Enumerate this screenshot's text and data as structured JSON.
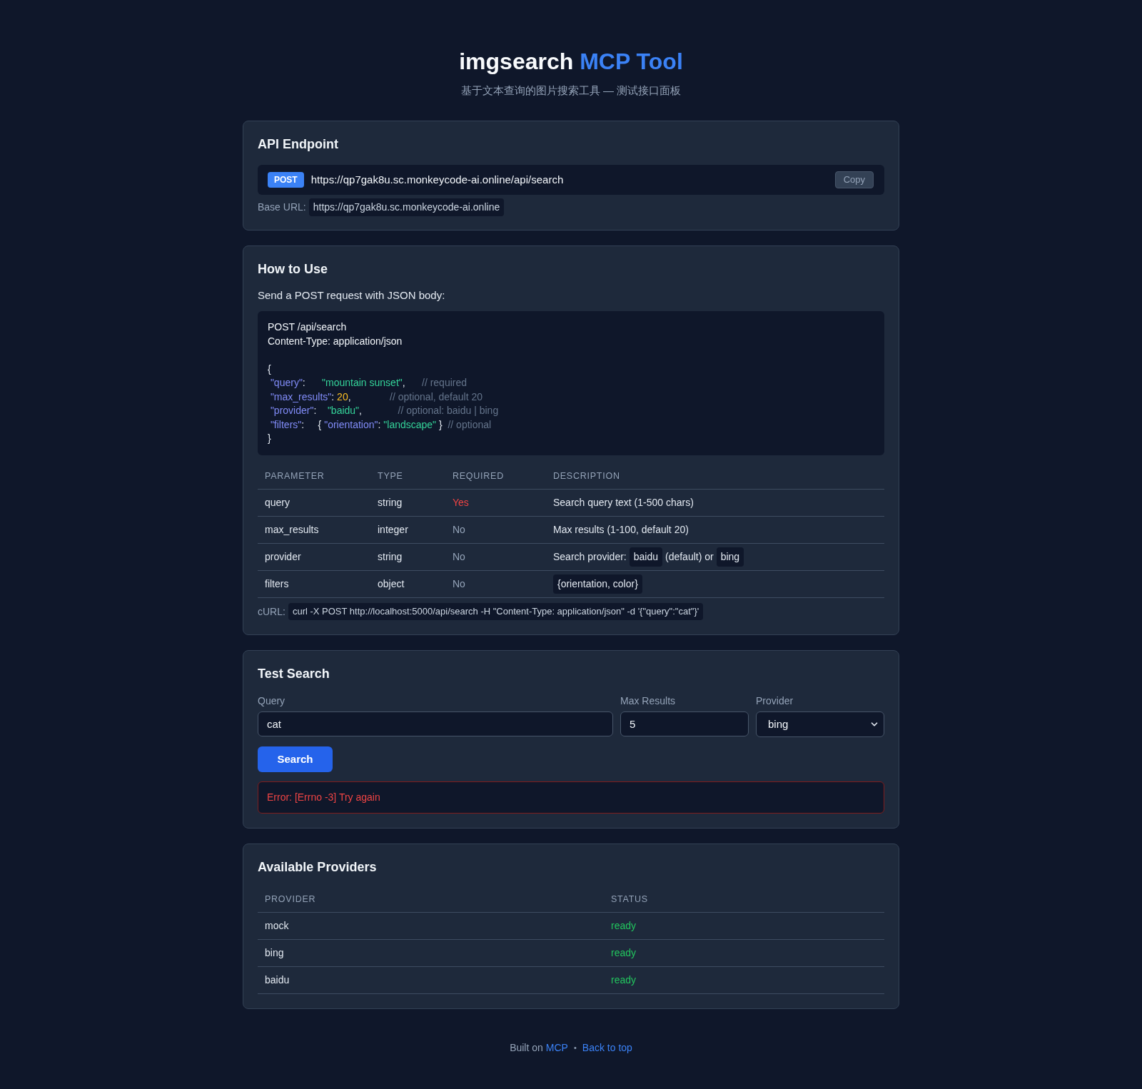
{
  "header": {
    "title": "imgsearch",
    "title_accent": "MCP Tool",
    "subtitle": "基于文本查询的图片搜索工具 — 测试接口面板"
  },
  "endpoint_card": {
    "heading": "API Endpoint",
    "method": "POST",
    "url": "https://qp7gak8u.sc.monkeycode-ai.online/api/search",
    "copy_button": "Copy",
    "base_url_label": "Base URL:",
    "base_url": "https://qp7gak8u.sc.monkeycode-ai.online"
  },
  "usage_card": {
    "heading": "How to Use",
    "intro": "Send a POST request with JSON body:",
    "request_lines": [
      "POST /api/search",
      "Content-Type: application/json"
    ],
    "body_lines": [
      [
        {
          "kind": "plain",
          "text": "{"
        }
      ],
      [
        {
          "kind": "key",
          "text": " \"query\""
        },
        {
          "kind": "plain",
          "text": ":      "
        },
        {
          "kind": "string",
          "text": "\"mountain sunset\""
        },
        {
          "kind": "plain",
          "text": ",      "
        },
        {
          "kind": "comment",
          "text": "// required"
        }
      ],
      [
        {
          "kind": "key",
          "text": " \"max_results\""
        },
        {
          "kind": "plain",
          "text": ": "
        },
        {
          "kind": "number",
          "text": "20"
        },
        {
          "kind": "plain",
          "text": ",              "
        },
        {
          "kind": "comment",
          "text": "// optional, default 20"
        }
      ],
      [
        {
          "kind": "key",
          "text": " \"provider\""
        },
        {
          "kind": "plain",
          "text": ":    "
        },
        {
          "kind": "string",
          "text": "\"baidu\""
        },
        {
          "kind": "plain",
          "text": ",             "
        },
        {
          "kind": "comment",
          "text": "// optional: baidu | bing"
        }
      ],
      [
        {
          "kind": "key",
          "text": " \"filters\""
        },
        {
          "kind": "plain",
          "text": ":     { "
        },
        {
          "kind": "key",
          "text": "\"orientation\""
        },
        {
          "kind": "plain",
          "text": ": "
        },
        {
          "kind": "string",
          "text": "\"landscape\""
        },
        {
          "kind": "plain",
          "text": " }  "
        },
        {
          "kind": "comment",
          "text": "// optional"
        }
      ],
      [
        {
          "kind": "plain",
          "text": "}"
        }
      ]
    ],
    "params_table": {
      "columns": [
        "PARAMETER",
        "TYPE",
        "REQUIRED",
        "DESCRIPTION"
      ],
      "rows": [
        {
          "parameter": "query",
          "type": "string",
          "required": {
            "text": "Yes",
            "on": true
          },
          "description": [
            {
              "kind": "text",
              "text": "Search query text (1-500 chars)"
            }
          ]
        },
        {
          "parameter": "max_results",
          "type": "integer",
          "required": {
            "text": "No",
            "on": false
          },
          "description": [
            {
              "kind": "text",
              "text": "Max results (1-100, default 20)"
            }
          ]
        },
        {
          "parameter": "provider",
          "type": "string",
          "required": {
            "text": "No",
            "on": false
          },
          "description": [
            {
              "kind": "text",
              "text": "Search provider:"
            },
            {
              "kind": "code",
              "text": "baidu"
            },
            {
              "kind": "text",
              "text": "(default) or"
            },
            {
              "kind": "code",
              "text": "bing"
            }
          ]
        },
        {
          "parameter": "filters",
          "type": "object",
          "required": {
            "text": "No",
            "on": false
          },
          "description": [
            {
              "kind": "code",
              "text": "{orientation, color}"
            }
          ]
        }
      ]
    },
    "curl_label": "cURL:",
    "curl": "curl -X POST http://localhost:5000/api/search -H \"Content-Type: application/json\" -d '{\"query\":\"cat\"}'"
  },
  "search_card": {
    "heading": "Test Search",
    "fields": [
      {
        "kind": "text",
        "label": "Query",
        "value": "cat"
      },
      {
        "kind": "number",
        "label": "Max Results",
        "value": "5"
      },
      {
        "kind": "select",
        "label": "Provider",
        "value": "bing"
      }
    ],
    "search_button": "Search",
    "error": "Error: [Errno -3] Try again"
  },
  "providers_card": {
    "heading": "Available Providers",
    "columns": [
      "PROVIDER",
      "STATUS"
    ],
    "rows": [
      {
        "provider": "mock",
        "status": "ready",
        "ready": true
      },
      {
        "provider": "bing",
        "status": "ready",
        "ready": true
      },
      {
        "provider": "baidu",
        "status": "ready",
        "ready": true
      }
    ]
  },
  "footer": {
    "built_on": "Built on",
    "link": "MCP",
    "separator": "•",
    "back_link": "Back to top"
  }
}
